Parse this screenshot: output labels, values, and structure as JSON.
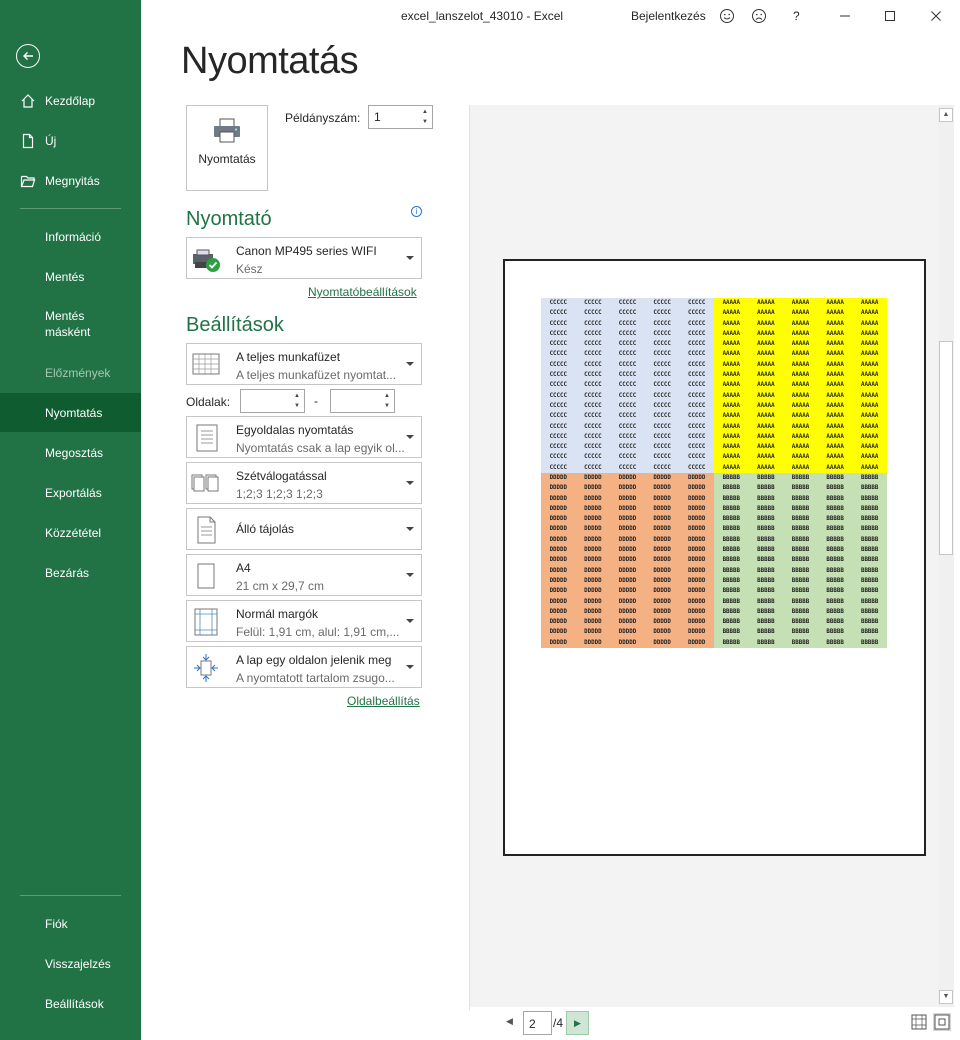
{
  "window": {
    "doc_title": "excel_lanszelot_43010  -  Excel",
    "signin": "Bejelentkezés",
    "help": "?"
  },
  "sidebar": {
    "items": [
      {
        "label": "Kezdőlap"
      },
      {
        "label": "Új"
      },
      {
        "label": "Megnyitás"
      },
      {
        "label": "Információ"
      },
      {
        "label": "Mentés"
      },
      {
        "label": "Mentés"
      },
      {
        "label": "másként"
      },
      {
        "label": "Előzmények"
      },
      {
        "label": "Nyomtatás"
      },
      {
        "label": "Megosztás"
      },
      {
        "label": "Exportálás"
      },
      {
        "label": "Közzététel"
      },
      {
        "label": "Bezárás"
      },
      {
        "label": "Fiók"
      },
      {
        "label": "Visszajelzés"
      },
      {
        "label": "Beállítások"
      }
    ]
  },
  "main": {
    "title": "Nyomtatás",
    "print_button": "Nyomtatás",
    "copies_label": "Példányszám:",
    "copies_value": "1",
    "printer_heading": "Nyomtató",
    "printer_name": "Canon MP495 series WIFI",
    "printer_status": "Kész",
    "printer_props": "Nyomtatóbeállítások",
    "settings_heading": "Beállítások",
    "settings": [
      {
        "l1": "A teljes munkafüzet",
        "l2": "A teljes munkafüzet nyomtat..."
      },
      {
        "l1": "Egyoldalas nyomtatás",
        "l2": "Nyomtatás csak a lap egyik ol..."
      },
      {
        "l1": "Szétválogatással",
        "l2": "1;2;3     1;2;3     1;2;3"
      },
      {
        "l1": "Álló tájolás",
        "l2": ""
      },
      {
        "l1": "A4",
        "l2": "21 cm x 29,7 cm"
      },
      {
        "l1": "Normál margók",
        "l2": "Felül: 1,91 cm, alul: 1,91 cm,..."
      },
      {
        "l1": "A lap egy oldalon jelenik meg",
        "l2": "A nyomtatott tartalom zsugo..."
      }
    ],
    "pages_label": "Oldalak:",
    "pages_dash": "-",
    "page_setup": "Oldalbeállítás"
  },
  "preview": {
    "current_page": "2",
    "total_pages": "/4",
    "blocks": [
      {
        "text": "CCCCC",
        "color": "#dae3f3"
      },
      {
        "text": "AAAAA",
        "color": "#ffff00"
      },
      {
        "text": "DDDDD",
        "color": "#f4b183"
      },
      {
        "text": "BBBBB",
        "color": "#c5e0b4"
      }
    ]
  },
  "colors": {
    "accent": "#217346",
    "sidebar_active": "#0e5c30"
  }
}
